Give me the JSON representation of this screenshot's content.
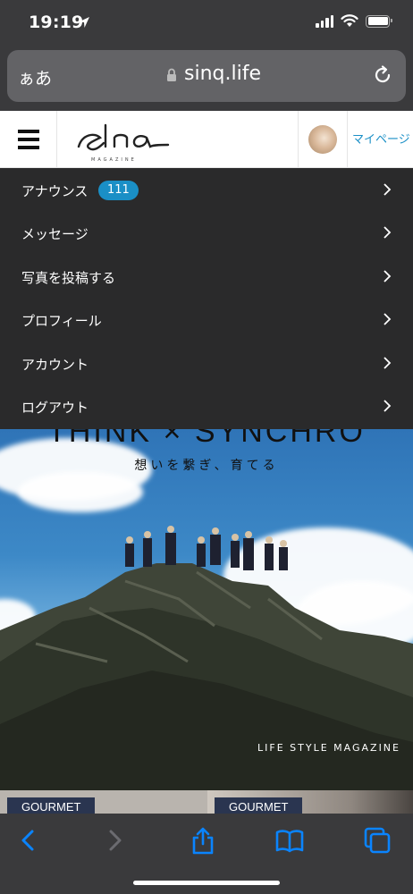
{
  "status_bar": {
    "time": "19:19"
  },
  "address_bar": {
    "text_size_label": "ぁあ",
    "url": "sinq.life"
  },
  "header": {
    "mypage_label": "マイページ"
  },
  "menu": {
    "items": [
      {
        "label": "アナウンス",
        "badge": "111"
      },
      {
        "label": "メッセージ"
      },
      {
        "label": "写真を投稿する"
      },
      {
        "label": "プロフィール"
      },
      {
        "label": "アカウント"
      },
      {
        "label": "ログアウト"
      }
    ]
  },
  "hero": {
    "heading": "THINK × SYNCHRO",
    "tagline": "想いを繋ぎ、育てる",
    "magazine_label": "LIFE STYLE MAGAZINE"
  },
  "categories": [
    "GOURMET",
    "GOURMET"
  ],
  "colors": {
    "accent": "#1a8fc6",
    "menu_bg": "#2a2a2b",
    "chrome": "#3a3a3c",
    "toolbar_icon": "#0a84ff"
  }
}
